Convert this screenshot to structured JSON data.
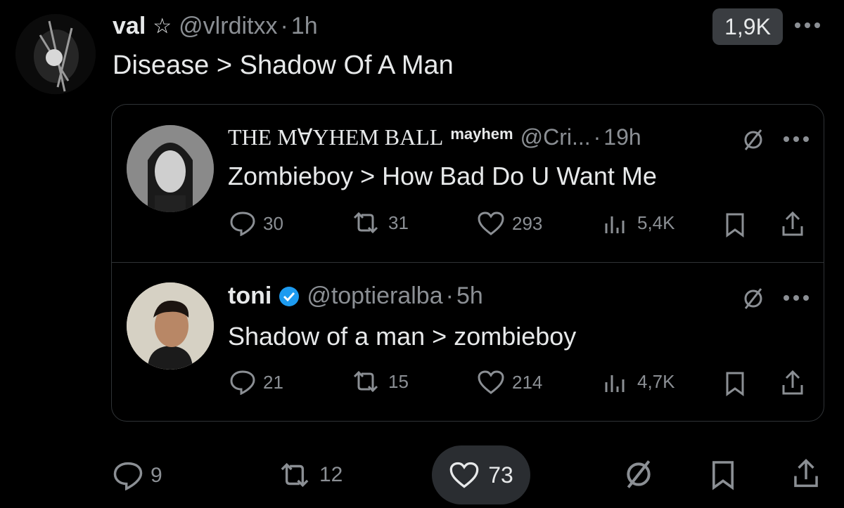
{
  "main_post": {
    "display_name": "val",
    "star": "☆",
    "handle": "@vlrditxx",
    "sep": "·",
    "time": "1h",
    "views_badge": "1,9K",
    "text": "Disease > Shadow Of A Man",
    "stats": {
      "replies": "9",
      "reposts": "12",
      "likes": "73"
    },
    "icons": [
      "reply-icon",
      "repost-icon",
      "like-icon",
      "grok-icon",
      "bookmark-icon",
      "share-icon"
    ]
  },
  "quoted_posts": [
    {
      "display_name": "THE M∀YHEM BALL",
      "name_suffix": "mayhem",
      "handle": "@Cri...",
      "sep": "·",
      "time": "19h",
      "text": "Zombieboy > How Bad Do U Want Me",
      "stats": {
        "replies": "30",
        "reposts": "31",
        "likes": "293",
        "views": "5,4K"
      }
    },
    {
      "display_name": "toni",
      "handle": "@toptieralba",
      "sep": "·",
      "time": "5h",
      "text": "Shadow of a man > zombieboy",
      "stats": {
        "replies": "21",
        "reposts": "15",
        "likes": "214",
        "views": "4,7K"
      }
    }
  ],
  "colors": {
    "background": "#000000",
    "text": "#e7e9ea",
    "muted": "#8b8f94",
    "border": "#2f3336",
    "verified": "#1d9bf0",
    "pill": "#2a2d31"
  }
}
